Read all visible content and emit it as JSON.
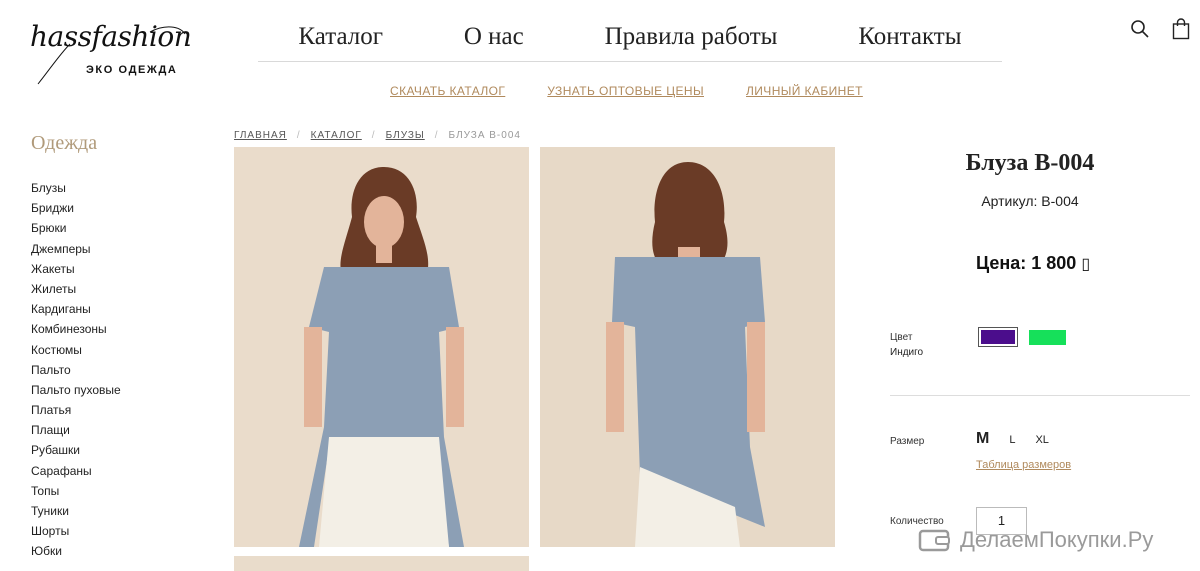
{
  "brand": {
    "name": "hassfashion",
    "tagline": "ЭКО ОДЕЖДА"
  },
  "main_nav": [
    "Каталог",
    "О нас",
    "Правила работы",
    "Контакты"
  ],
  "sub_nav": [
    "СКАЧАТЬ КАТАЛОГ",
    "УЗНАТЬ ОПТОВЫЕ ЦЕНЫ",
    "ЛИЧНЫЙ КАБИНЕТ"
  ],
  "header_icons": [
    "search-icon",
    "cart-icon"
  ],
  "sidebar": {
    "title": "Одежда",
    "items": [
      "Блузы",
      "Бриджи",
      "Брюки",
      "Джемперы",
      "Жакеты",
      "Жилеты",
      "Кардиганы",
      "Комбинезоны",
      "Костюмы",
      "Пальто",
      "Пальто пуховые",
      "Платья",
      "Плащи",
      "Рубашки",
      "Сарафаны",
      "Топы",
      "Туники",
      "Шорты",
      "Юбки"
    ]
  },
  "breadcrumb": [
    "ГЛАВНАЯ",
    "КАТАЛОГ",
    "БЛУЗЫ",
    "БЛУЗА B-004"
  ],
  "product": {
    "title": "Блуза B-004",
    "sku": "Артикул: B-004",
    "price": "Цена: 1 800 ",
    "currency_glyph": "▯",
    "color_label": "Цвет",
    "color_value": "Индиго",
    "colors": [
      "#4b0d8c",
      "#16e05a"
    ],
    "size_label": "Размер",
    "sizes": [
      "M",
      "L",
      "XL"
    ],
    "size_table": "Таблица размеров",
    "qty_label": "Количество",
    "qty_value": "1"
  },
  "watermark": "ДелаемПокупки.Ру"
}
